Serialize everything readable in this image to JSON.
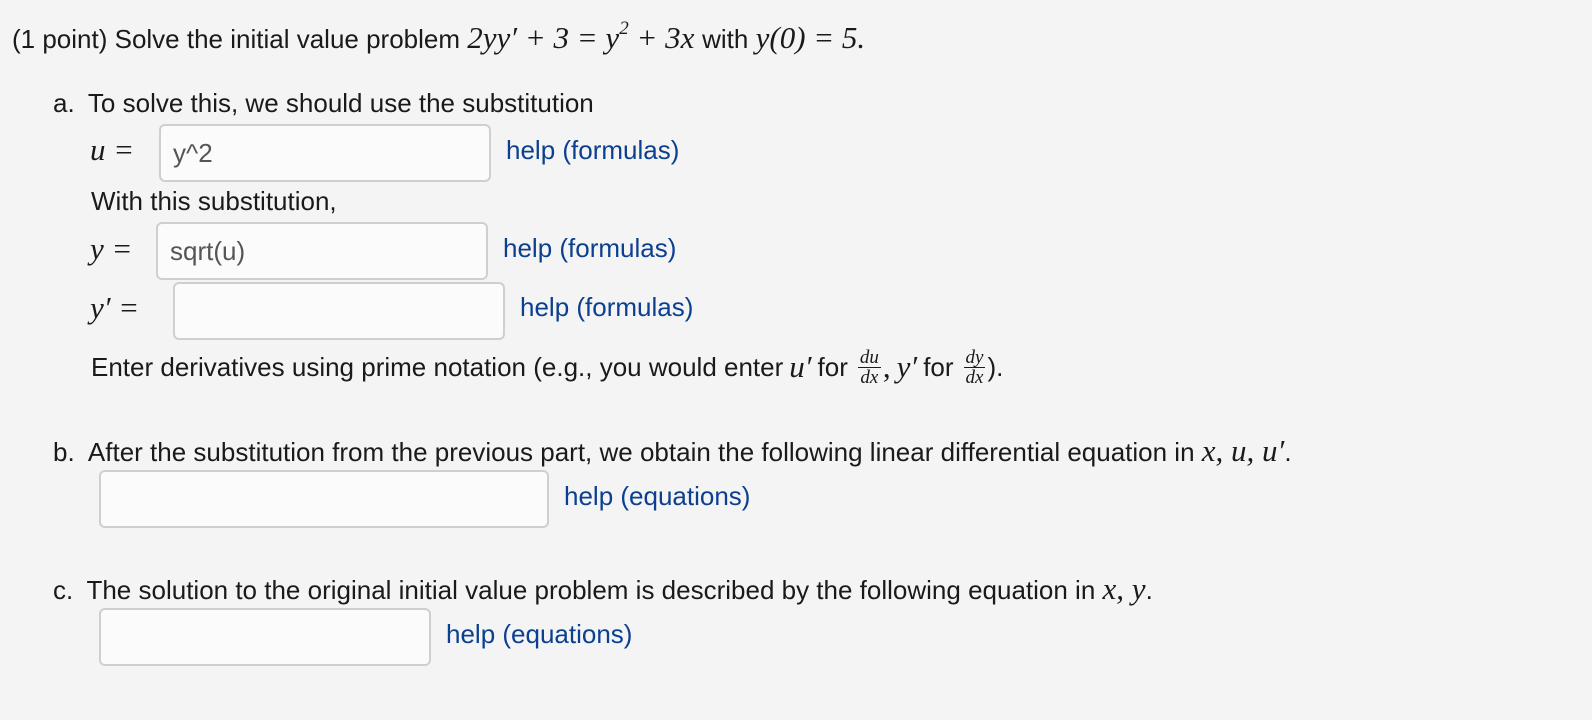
{
  "problem": {
    "intro": "(1 point) Solve the initial value problem",
    "equation_lhs": "2yy",
    "equation_mid": "+ 3 = y",
    "equation_exp": "2",
    "equation_rhs": "+ 3x",
    "with_text": "with",
    "initial_condition": "y(0) = 5."
  },
  "part_a": {
    "marker": "a.",
    "prompt": "To solve this, we should use the substitution",
    "u_label": "u =",
    "u_value": "y^2",
    "u_help": "help (formulas)",
    "with_sub_text": "With this substitution,",
    "y_label": "y =",
    "y_value": "sqrt(u)",
    "y_help": "help (formulas)",
    "yprime_label": "y′ =",
    "yprime_value": "",
    "yprime_help": "help (formulas)",
    "note_start": "Enter derivatives using prime notation (e.g., you would enter",
    "note_u": "u′",
    "note_for1": "for",
    "frac1_num": "du",
    "frac1_den": "dx",
    "note_comma": ",",
    "note_y": "y′",
    "note_for2": "for",
    "frac2_num": "dy",
    "frac2_den": "dx",
    "note_end": ")."
  },
  "part_b": {
    "marker": "b.",
    "prompt": "After the substitution from the previous part, we obtain the following linear differential equation in",
    "vars": "x, u, u′",
    "period": ".",
    "answer_value": "",
    "help": "help (equations)"
  },
  "part_c": {
    "marker": "c.",
    "prompt": "The solution to the original initial value problem is described by the following equation in",
    "vars": "x, y",
    "period": ".",
    "answer_value": "",
    "help": "help (equations)"
  }
}
